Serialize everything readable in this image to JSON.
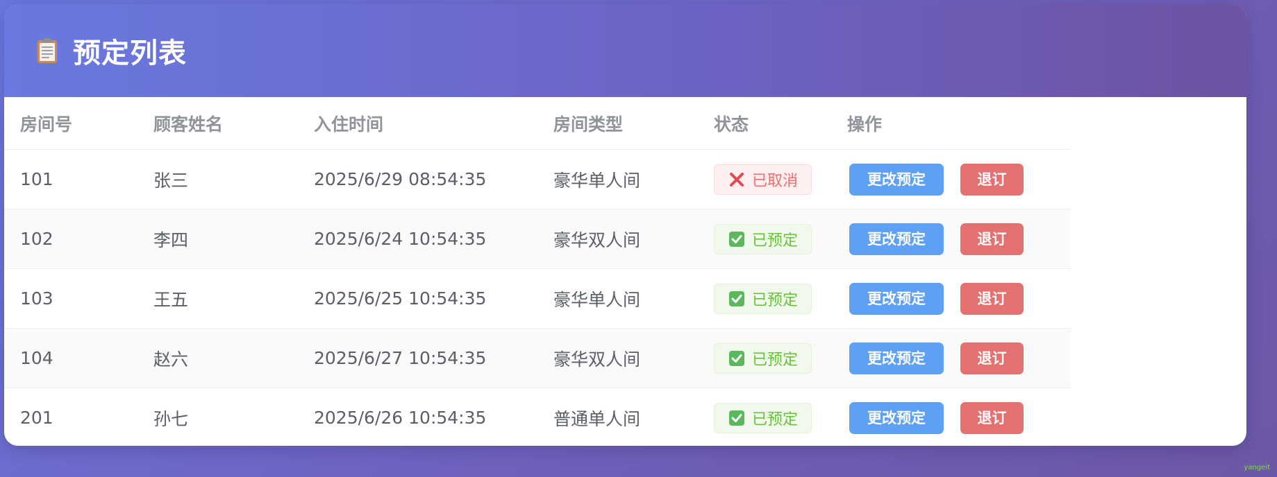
{
  "header": {
    "title": "预定列表",
    "icon": "clipboard-icon"
  },
  "table": {
    "columns": [
      "房间号",
      "顾客姓名",
      "入住时间",
      "房间类型",
      "状态",
      "操作"
    ],
    "rows": [
      {
        "room": "101",
        "guest": "张三",
        "checkin": "2025/6/29 08:54:35",
        "type": "豪华单人间",
        "status": "已取消",
        "status_kind": "cancelled",
        "status_icon": "cross-icon",
        "change_label": "更改预定",
        "cancel_label": "退订"
      },
      {
        "room": "102",
        "guest": "李四",
        "checkin": "2025/6/24 10:54:35",
        "type": "豪华双人间",
        "status": "已预定",
        "status_kind": "booked",
        "status_icon": "check-box-icon",
        "change_label": "更改预定",
        "cancel_label": "退订"
      },
      {
        "room": "103",
        "guest": "王五",
        "checkin": "2025/6/25 10:54:35",
        "type": "豪华单人间",
        "status": "已预定",
        "status_kind": "booked",
        "status_icon": "check-box-icon",
        "change_label": "更改预定",
        "cancel_label": "退订"
      },
      {
        "room": "104",
        "guest": "赵六",
        "checkin": "2025/6/27 10:54:35",
        "type": "豪华双人间",
        "status": "已预定",
        "status_kind": "booked",
        "status_icon": "check-box-icon",
        "change_label": "更改预定",
        "cancel_label": "退订"
      },
      {
        "room": "201",
        "guest": "孙七",
        "checkin": "2025/6/26 10:54:35",
        "type": "普通单人间",
        "status": "已预定",
        "status_kind": "booked",
        "status_icon": "check-box-icon",
        "change_label": "更改预定",
        "cancel_label": "退订"
      }
    ]
  },
  "colors": {
    "header_gradient_start": "#6a79df",
    "header_gradient_end": "#6e52a3",
    "change_button": "#5ea0f3",
    "cancel_button": "#e4716f",
    "status_cancelled": "#f56c6c",
    "status_booked": "#67c23a"
  },
  "watermark": "yangeit"
}
